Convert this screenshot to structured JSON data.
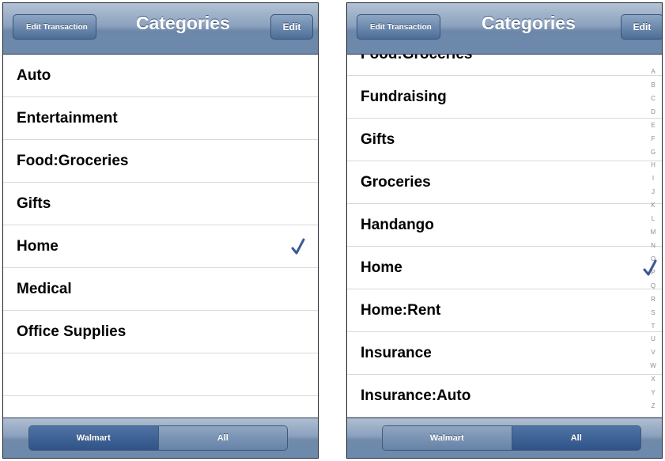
{
  "left": {
    "back_label": "Edit Transaction",
    "title": "Categories",
    "edit_label": "Edit",
    "rows": [
      "Auto",
      "Entertainment",
      "Food:Groceries",
      "Gifts",
      "Home",
      "Medical",
      "Office Supplies",
      "",
      ""
    ],
    "checked_row": "Home",
    "segments": [
      "Walmart",
      "All"
    ],
    "selected_segment": "Walmart"
  },
  "right": {
    "back_label": "Edit Transaction",
    "title": "Categories",
    "edit_label": "Edit",
    "rows": [
      "Food:Groceries",
      "Fundraising",
      "Gifts",
      "Groceries",
      "Handango",
      "Home",
      "Home:Rent",
      "Insurance",
      "Insurance:Auto"
    ],
    "checked_row": "Home",
    "index_letters": [
      "A",
      "B",
      "C",
      "D",
      "E",
      "F",
      "G",
      "H",
      "I",
      "J",
      "K",
      "L",
      "M",
      "N",
      "O",
      "P",
      "Q",
      "R",
      "S",
      "T",
      "U",
      "V",
      "W",
      "X",
      "Y",
      "Z"
    ],
    "segments": [
      "Walmart",
      "All"
    ],
    "selected_segment": "All"
  },
  "colors": {
    "accent": "#3b5fa0",
    "nav_bar": "#6d89ab",
    "check": "#3a5a96"
  }
}
